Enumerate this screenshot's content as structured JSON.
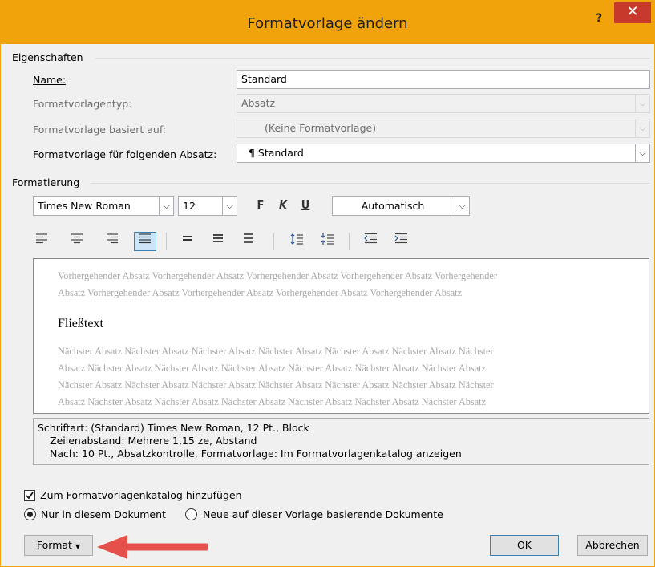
{
  "window": {
    "title": "Formatvorlage ändern",
    "help": "?",
    "close": "✕"
  },
  "properties": {
    "group_label": "Eigenschaften",
    "name_label": "Name:",
    "name_value": "Standard",
    "type_label": "Formatvorlagentyp:",
    "type_value": "Absatz",
    "based_on_label": "Formatvorlage basiert auf:",
    "based_on_value": "(Keine Formatvorlage)",
    "following_label": "Formatvorlage für folgenden Absatz:",
    "following_value": "¶ Standard"
  },
  "formatting": {
    "group_label": "Formatierung",
    "font": "Times New Roman",
    "size": "12",
    "bold": "F",
    "italic": "K",
    "underline": "U",
    "color": "Automatisch"
  },
  "preview": {
    "previous_lines": [
      "Vorhergehender Absatz Vorhergehender Absatz Vorhergehender Absatz Vorhergehender Absatz Vorhergehender",
      "Absatz Vorhergehender Absatz Vorhergehender Absatz Vorhergehender Absatz Vorhergehender Absatz"
    ],
    "sample": "Fließtext",
    "next_lines": [
      "Nächster Absatz Nächster Absatz Nächster Absatz Nächster Absatz Nächster Absatz Nächster Absatz Nächster",
      "Absatz Nächster Absatz Nächster Absatz Nächster Absatz Nächster Absatz Nächster Absatz Nächster Absatz",
      "Nächster Absatz Nächster Absatz Nächster Absatz Nächster Absatz Nächster Absatz Nächster Absatz Nächster",
      "Absatz Nächster Absatz Nächster Absatz Nächster Absatz Nächster Absatz Nächster Absatz Nächster Absatz"
    ]
  },
  "description": {
    "line1": "Schriftart: (Standard) Times New Roman, 12 Pt., Block",
    "line2": "Zeilenabstand:  Mehrere 1,15 ze, Abstand",
    "line3": "Nach:  10 Pt., Absatzkontrolle, Formatvorlage: Im Formatvorlagenkatalog anzeigen"
  },
  "options": {
    "add_to_gallery": "Zum Formatvorlagenkatalog hinzufügen",
    "add_to_gallery_checked": true,
    "only_this_document": "Nur in diesem Dokument",
    "new_documents": "Neue auf dieser Vorlage basierende Dokumente"
  },
  "buttons": {
    "format": "Format",
    "ok": "OK",
    "cancel": "Abbrechen"
  },
  "colors": {
    "titlebar": "#f0a30a",
    "close": "#c7392b",
    "arrow": "#e5504a"
  }
}
